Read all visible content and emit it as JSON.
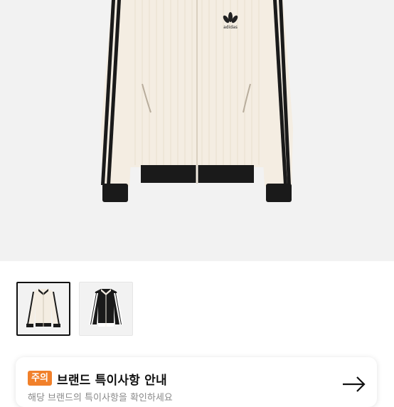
{
  "product": {
    "logo_text": "adidas"
  },
  "thumbnails": [
    {
      "name": "ivory-jacket",
      "selected": true
    },
    {
      "name": "black-jacket",
      "selected": false
    }
  ],
  "notice": {
    "badge": "주의",
    "title": "브랜드 특이사항 안내",
    "subtitle": "해당 브랜드의 특이사항을 확인하세요"
  },
  "colors": {
    "accent": "#f1802a",
    "hero_bg": "#f2f2f2",
    "jacket_ivory": "#f4ede2",
    "jacket_black": "#1a1a1a"
  }
}
